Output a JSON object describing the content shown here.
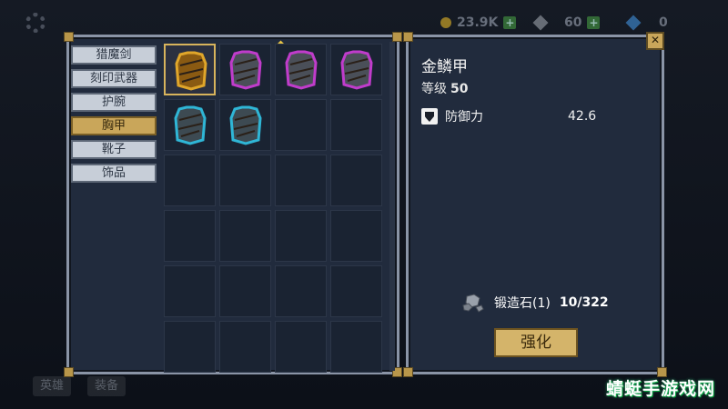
{
  "topbar": {
    "gold": "23.9K",
    "keys": "60",
    "gems": "0"
  },
  "bottom": {
    "hero_label": "英雄",
    "equip_label": "装备"
  },
  "tabs": [
    {
      "label": "猎魔剑",
      "active": false
    },
    {
      "label": "刻印武器",
      "active": false
    },
    {
      "label": "护腕",
      "active": false
    },
    {
      "label": "胸甲",
      "active": true
    },
    {
      "label": "靴子",
      "active": false
    },
    {
      "label": "饰品",
      "active": false
    }
  ],
  "inventory": [
    {
      "icon": "gold-armor-icon",
      "rarity": "legendary",
      "color": "#e0a62a",
      "selected": true
    },
    {
      "icon": "steel-armor-icon",
      "rarity": "epic",
      "color": "#c03ccb",
      "new": true
    },
    {
      "icon": "mossy-armor-icon",
      "rarity": "epic",
      "color": "#c03ccb"
    },
    {
      "icon": "purple-robe-icon",
      "rarity": "epic",
      "color": "#c03ccb"
    },
    {
      "icon": "teal-robe-icon",
      "rarity": "rare",
      "color": "#2fb6d6"
    },
    {
      "icon": "teal-vest-icon",
      "rarity": "rare",
      "color": "#2fb6d6"
    }
  ],
  "detail": {
    "name": "金鳞甲",
    "level_label": "等级",
    "level_value": "50",
    "stat_label": "防御力",
    "stat_value": "42.6",
    "material_label": "锻造石(1)",
    "material_count": "10/322",
    "upgrade_label": "强化",
    "close_label": "✕"
  },
  "watermark": "蜻蜓手游戏网",
  "colors": {
    "panel_bg": "#212b3d",
    "tab_active": "#c9a65a",
    "legendary": "#e0a62a",
    "epic": "#c03ccb",
    "rare": "#2fb6d6"
  }
}
